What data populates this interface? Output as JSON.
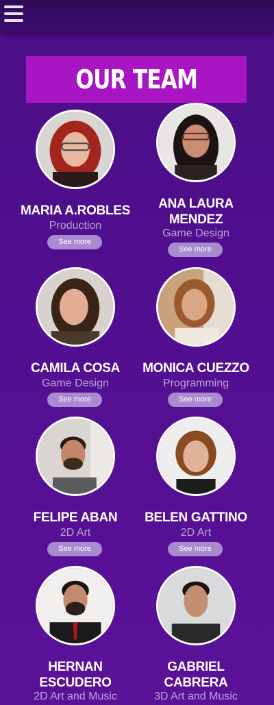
{
  "header": {
    "menu_icon": "hamburger-menu-icon"
  },
  "title": "OUR TEAM",
  "see_more_label": "See more",
  "colors": {
    "background": "#520f91",
    "banner": "#a815c2",
    "button": "#a98ad0",
    "role_text": "#b9a7d4"
  },
  "team": [
    {
      "name": "MARIA A.ROBLES",
      "role": "Production"
    },
    {
      "name": "ANA LAURA MENDEZ",
      "role": "Game Design"
    },
    {
      "name": "CAMILA COSA",
      "role": "Game Design"
    },
    {
      "name": "MONICA CUEZZO",
      "role": "Programming"
    },
    {
      "name": "FELIPE ABAN",
      "role": "2D Art"
    },
    {
      "name": "BELEN GATTINO",
      "role": "2D Art"
    },
    {
      "name": "HERNAN ESCUDERO",
      "role": "2D Art and Music"
    },
    {
      "name": "GABRIEL CABRERA",
      "role": "3D Art and Music"
    }
  ]
}
